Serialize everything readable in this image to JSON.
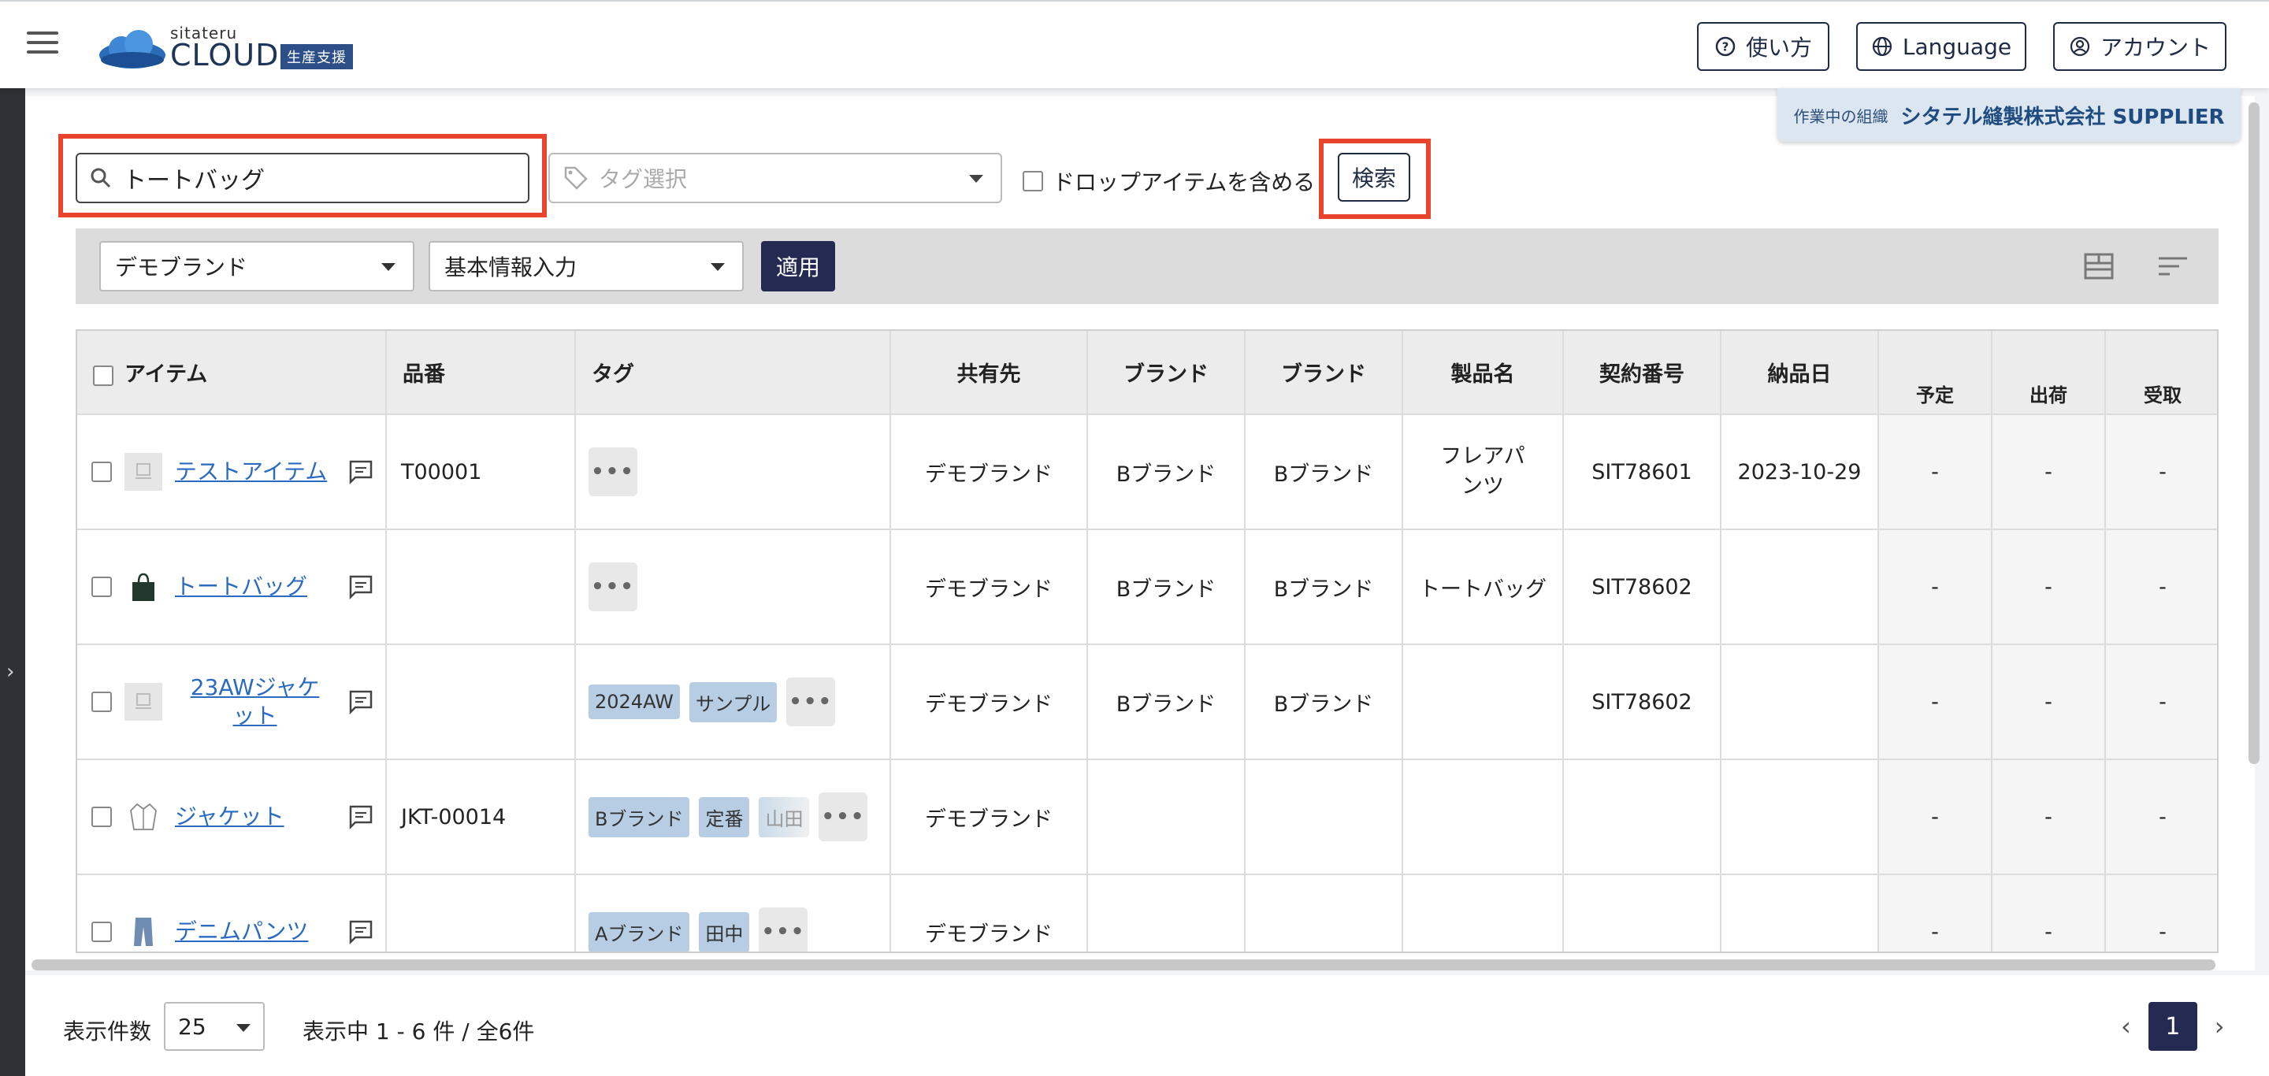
{
  "header": {
    "logo_top": "sitateru",
    "logo_main": "CLOUD",
    "logo_tag": "生産支援",
    "help_label": "使い方",
    "language_label": "Language",
    "account_label": "アカウント"
  },
  "org": {
    "label": "作業中の組織",
    "value": "シタテル縫製株式会社 SUPPLIER"
  },
  "search": {
    "value": "トートバッグ",
    "tag_placeholder": "タグ選択",
    "drop_label": "ドロップアイテムを含める",
    "search_button": "検索"
  },
  "filter": {
    "brand": "デモブランド",
    "stage": "基本情報入力",
    "apply": "適用"
  },
  "table": {
    "headers": {
      "item": "アイテム",
      "code": "品番",
      "tag": "タグ",
      "share": "共有先",
      "brand1": "ブランド",
      "brand2": "ブランド",
      "product": "製品名",
      "contract": "契約番号",
      "delivery": "納品日",
      "planned": "予定",
      "shipped": "出荷",
      "received": "受取"
    },
    "rows": [
      {
        "name": "テストアイテム",
        "code": "T00001",
        "tags": [],
        "share": "デモブランド",
        "brand1": "Bブランド",
        "brand2": "Bブランド",
        "product": "フレアパンツ",
        "contract": "SIT78601",
        "delivery": "2023-10-29",
        "planned": "-",
        "shipped": "-",
        "received": "-"
      },
      {
        "name": "トートバッグ",
        "code": "",
        "tags": [],
        "share": "デモブランド",
        "brand1": "Bブランド",
        "brand2": "Bブランド",
        "product": "トートバッグ",
        "contract": "SIT78602",
        "delivery": "",
        "planned": "-",
        "shipped": "-",
        "received": "-"
      },
      {
        "name": "23AWジャケット",
        "code": "",
        "tags": [
          "2024AW",
          "サンプル"
        ],
        "share": "デモブランド",
        "brand1": "Bブランド",
        "brand2": "Bブランド",
        "product": "",
        "contract": "SIT78602",
        "delivery": "",
        "planned": "-",
        "shipped": "-",
        "received": "-"
      },
      {
        "name": "ジャケット",
        "code": "JKT-00014",
        "tags": [
          "Bブランド",
          "定番",
          "山田"
        ],
        "share": "デモブランド",
        "brand1": "",
        "brand2": "",
        "product": "",
        "contract": "",
        "delivery": "",
        "planned": "-",
        "shipped": "-",
        "received": "-"
      },
      {
        "name": "デニムパンツ",
        "code": "",
        "tags": [
          "Aブランド",
          "田中"
        ],
        "share": "デモブランド",
        "brand1": "",
        "brand2": "",
        "product": "",
        "contract": "",
        "delivery": "",
        "planned": "-",
        "shipped": "-",
        "received": "-"
      }
    ],
    "more_label": "•••"
  },
  "footer": {
    "per_label": "表示件数",
    "per_value": "25",
    "showing": "表示中 1 - 6 件 / 全6件",
    "page": "1"
  },
  "colors": {
    "highlight": "#e8452c",
    "primary": "#252a52",
    "link": "#2a6bbf",
    "tag_bg": "#b7cde3"
  }
}
